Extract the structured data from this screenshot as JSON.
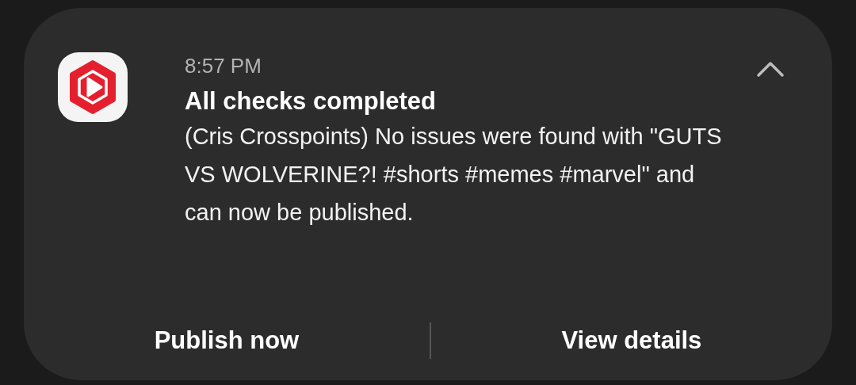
{
  "notification": {
    "time": "8:57 PM",
    "title": "All checks completed",
    "body": "(Cris Crosspoints) No issues were found with \"GUTS VS WOLVERINE?! #shorts #memes #marvel\" and can now be published.",
    "expanded": true,
    "actions": [
      {
        "label": "Publish now"
      },
      {
        "label": "View details"
      }
    ]
  }
}
